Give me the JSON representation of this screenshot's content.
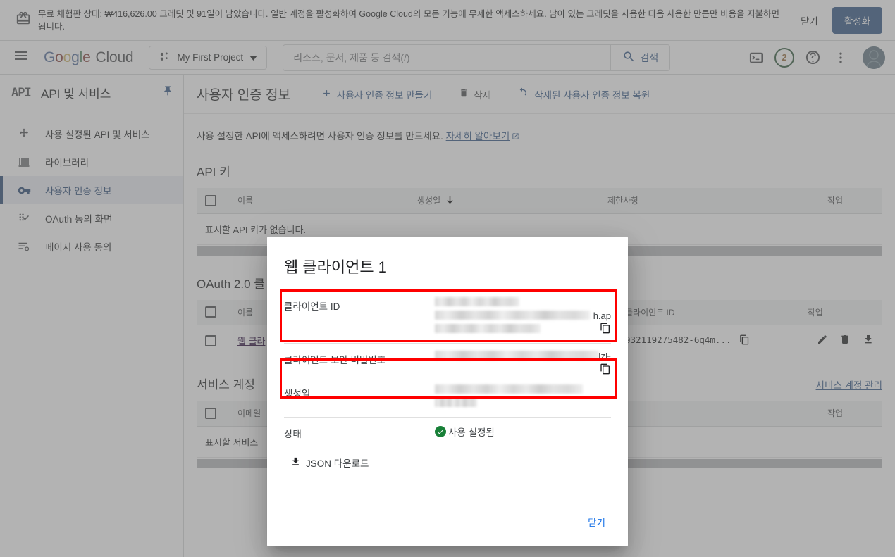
{
  "banner": {
    "icon": "gift-icon",
    "text": "무료 체험판 상태: ₩416,626.00 크레딧 및 91일이 남았습니다. 일반 계정을 활성화하여 Google Cloud의 모든 기능에 무제한 액세스하세요. 남아 있는 크레딧을 사용한 다음 사용한 만큼만 비용을 지불하면 됩니다.",
    "dismiss_label": "닫기",
    "activate_label": "활성화",
    "activate_color": "#1a73e8"
  },
  "appbar": {
    "brand": "Google Cloud",
    "project_name": "My First Project",
    "search_placeholder": "리소스, 문서, 제품 등 검색(/)",
    "search_value": "",
    "search_button_label": "검색",
    "notification_count": "2",
    "icons": [
      "cloud-shell-icon",
      "notifications-icon",
      "help-icon",
      "more-vert-icon",
      "avatar"
    ]
  },
  "sidebar": {
    "logo": "API",
    "title": "API 및 서비스",
    "pin_icon": "pin-icon",
    "items": [
      {
        "label": "사용 설정된 API 및 서비스",
        "icon": "enabled-apis-icon",
        "active": false
      },
      {
        "label": "라이브러리",
        "icon": "library-icon",
        "active": false
      },
      {
        "label": "사용자 인증 정보",
        "icon": "key-icon",
        "active": true
      },
      {
        "label": "OAuth 동의 화면",
        "icon": "oauth-consent-icon",
        "active": false
      },
      {
        "label": "페이지 사용 동의",
        "icon": "page-consent-icon",
        "active": false
      }
    ]
  },
  "content": {
    "page_title": "사용자 인증 정보",
    "actions": [
      {
        "label": "사용자 인증 정보 만들기",
        "icon": "plus-icon",
        "style": "blue"
      },
      {
        "label": "삭제",
        "icon": "trash-icon",
        "style": "gray"
      },
      {
        "label": "삭제된 사용자 인증 정보 복원",
        "icon": "restore-icon",
        "style": "blue2"
      }
    ],
    "info_text": "사용 설정한 API에 액세스하려면 사용자 인증 정보를 만드세요.",
    "info_link": "자세히 알아보기",
    "api_keys": {
      "title": "API 키",
      "columns": [
        "이름",
        "생성일",
        "제한사항",
        "작업"
      ],
      "sort_column": "생성일",
      "sort_icon": "arrow-down-icon",
      "empty_text": "표시할 API 키가 없습니다."
    },
    "oauth_clients": {
      "title": "OAuth 2.0 클",
      "columns": [
        "이름",
        "클라이언트 ID",
        "작업"
      ],
      "rows": [
        {
          "name": "웹 클라",
          "client_id": "932119275482-6q4m...",
          "actions": [
            "edit-icon",
            "trash-icon",
            "download-icon"
          ]
        }
      ]
    },
    "service_accounts": {
      "title": "서비스 계정",
      "manage_link": "서비스 계정 관리",
      "columns": [
        "이메일",
        "작업"
      ],
      "empty_text": "표시할 서비스"
    }
  },
  "modal": {
    "title": "웹 클라이언트 1",
    "rows": [
      {
        "label": "클라이언트 ID",
        "value_redacted": true,
        "visible_tail": "h.ap",
        "copy_icon": "copy-icon",
        "highlighted": true
      },
      {
        "label": "클라이언트 보안 비밀번호",
        "value_redacted": true,
        "visible_tail": "IzF",
        "copy_icon": "copy-icon",
        "highlighted": true
      },
      {
        "label": "생성일",
        "value_redacted": true,
        "visible_tail": "",
        "highlighted": false
      },
      {
        "label": "상태",
        "value": "사용 설정됨",
        "status_icon": "check-circle-icon",
        "status_color": "#188038",
        "highlighted": false
      }
    ],
    "download_label": "JSON 다운로드",
    "download_icon": "download-icon",
    "close_label": "닫기",
    "highlight_color": "#ff0000"
  }
}
